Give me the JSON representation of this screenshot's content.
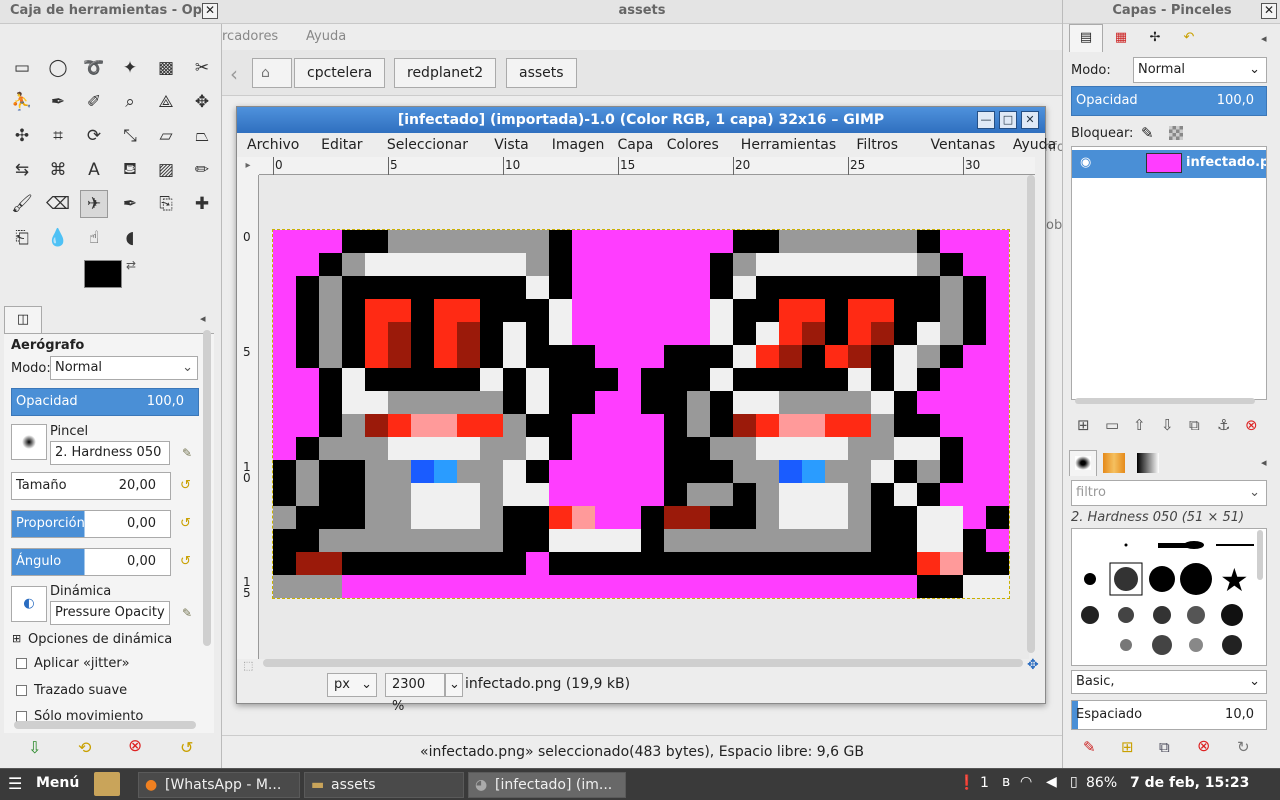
{
  "file_manager": {
    "title": "assets",
    "menu_partial": "rcadores",
    "menu_help": "Ayuda",
    "breadcrumbs": [
      "cpctelera",
      "redplanet2",
      "assets"
    ],
    "status": "«infectado.png» seleccionado(483 bytes), Espacio libre: 9,6 GB",
    "side_text_1": "nfo",
    "side_text_2": "ob"
  },
  "toolbox": {
    "title": "Caja de herramientas - Opci",
    "tool_name": "Aerógrafo",
    "mode_label": "Modo:",
    "mode_value": "Normal",
    "opacity_label": "Opacidad",
    "opacity_value": "100,0",
    "brush_label": "Pincel",
    "brush_value": "2. Hardness 050",
    "size_label": "Tamaño",
    "size_value": "20,00",
    "ratio_label": "Proporción d...",
    "ratio_value": "0,00",
    "angle_label": "Ángulo",
    "angle_value": "0,00",
    "dynamics_label": "Dinámica",
    "dynamics_value": "Pressure Opacity",
    "dyn_options": "Opciones de dinámica",
    "jitter": "Aplicar «jitter»",
    "smooth": "Trazado suave",
    "motion_only": "Sólo movimiento"
  },
  "image_window": {
    "title": "[infectado] (importada)-1.0 (Color RGB, 1 capa) 32x16 – GIMP",
    "menu": [
      "Archivo",
      "Editar",
      "Seleccionar",
      "Vista",
      "Imagen",
      "Capa",
      "Colores",
      "Herramientas",
      "Filtros",
      "Ventanas",
      "Ayuda"
    ],
    "ruler_h": [
      "0",
      "5",
      "10",
      "15",
      "20",
      "25",
      "30"
    ],
    "ruler_v": [
      "0",
      "5",
      "1\n0",
      "1\n5"
    ],
    "unit": "px",
    "zoom": "2300 %",
    "file_info": "infectado.png (19,9 kB)"
  },
  "layers": {
    "title": "Capas - Pinceles",
    "mode_label": "Modo:",
    "mode_value": "Normal",
    "opacity_label": "Opacidad",
    "opacity_value": "100,0",
    "lock_label": "Bloquear:",
    "layer_name": "infectado.pn",
    "filter_placeholder": "filtro",
    "brush_name": "2. Hardness 050 (51 × 51)",
    "brush_set": "Basic,",
    "spacing_label": "Espaciado",
    "spacing_value": "10,0"
  },
  "taskbar": {
    "menu": "Menú",
    "items": [
      "[WhatsApp - M...",
      "assets",
      "[infectado] (im..."
    ],
    "notif": "1",
    "battery": "86%",
    "datetime": "7 de feb, 15:23"
  },
  "colors": {
    "magenta": "#ff3dff",
    "black": "#000000",
    "grey": "#999999",
    "white": "#f0f0f0",
    "red": "#ff2a14",
    "darkred": "#9b1a0a",
    "pink": "#ff9a9a",
    "blue": "#1a5cff",
    "lightblue": "#2a9cff",
    "accent": "#4a8fd6"
  },
  "sprite": [
    "MMMKKGGGGGGGKMMMMMMMKKGGGGGGKMMM",
    "MMKGWWWWWWWGKMMMMMMKGWWWWWWWGKMM",
    "MKGKKKKKKKKWKMMMMMMKWKKKKKKKKGKM",
    "MKGKRRKRRKKKWMMMMMMWKKRRKRRKKGKM",
    "MKGKRDKRDKWKWMMMMMMWKWRDKRDKWGKM",
    "MKGKRDKRDKWKKKMMMKKKWRDKRDKWGKMM",
    "MMKWKKKKKWKWKKKMKKKWKKKKKWKWKMMM",
    "MMKWWGGGGGKWKKMMKKGKWWGGGGWKMMMM",
    "MMKGDRPPRRGKKMMMMKGKDRPPRRGKKMMM",
    "MKGGGWWWWGGWKMMMMKKGGWWWWGGWWKMM",
    "KGKKGGBLGGWKMMMMMKKKGGBLGGWKGKMM",
    "KGKKGGWWWGWWMMMMMKGGKGWWWGKWKMMM",
    "GKKKGGWWWGKKRPMMKDDKKGWWWGKKWWMK",
    "KKGGGGGGGGKKWWWWKGGGGGGGGGKKWWKM",
    "KDDKKKKKKKKMKKKKKKKKKKKKKKKKRPKK",
    "GGGMMMMMMMMMMMMMMMMMMMMMMMMMKKWWK"
  ]
}
